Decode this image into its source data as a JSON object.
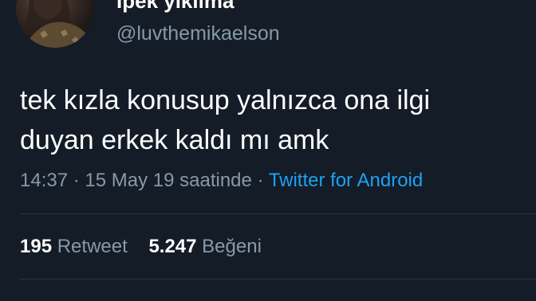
{
  "user": {
    "display_name": "İpek yıkılma",
    "handle": "@luvthemikaelson"
  },
  "tweet": {
    "text": "tek kızla konusup yalnızca ona ilgi\nduyan erkek kaldı mı amk",
    "time": "14:37",
    "date": "15 May 19 saatinde",
    "separator": "·",
    "source": "Twitter for Android"
  },
  "stats": {
    "retweets_count": "195",
    "retweets_label": "Retweet",
    "likes_count": "5.247",
    "likes_label": "Beğeni"
  },
  "colors": {
    "background": "#131c27",
    "secondary_text": "#8899a6",
    "link": "#1da1f2"
  }
}
